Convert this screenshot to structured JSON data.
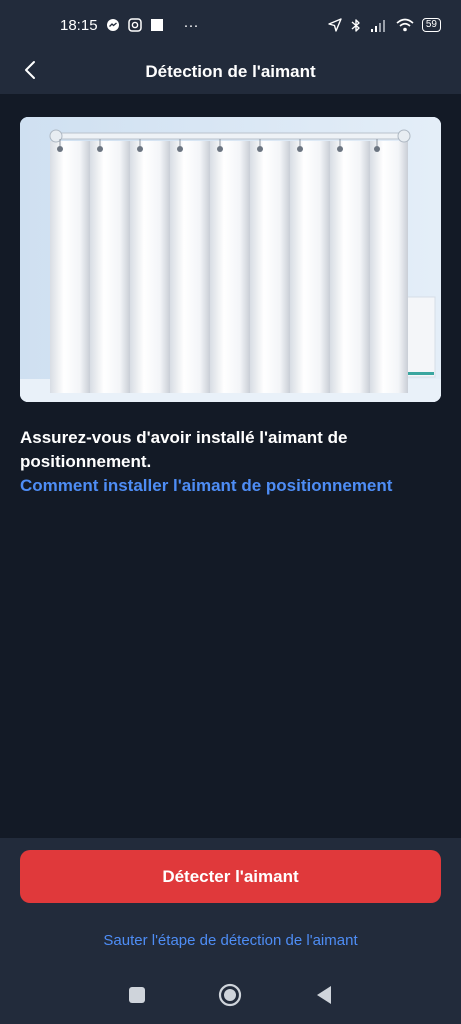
{
  "status_bar": {
    "time": "18:15",
    "more": "···",
    "battery": "59",
    "icons": [
      "messenger-icon",
      "camera-icon",
      "square-app-icon",
      "location-icon",
      "bluetooth-icon",
      "signal-icon",
      "wifi-icon",
      "battery-icon"
    ]
  },
  "header": {
    "title": "Détection de l'aimant",
    "back_icon": "chevron-left-icon"
  },
  "content": {
    "instruction": "Assurez-vous d'avoir installé l'aimant de positionnement.",
    "help_link": "Comment installer l'aimant de positionnement"
  },
  "footer": {
    "detect_button": "Détecter l'aimant",
    "skip_link": "Sauter l'étape de détection de l'aimant"
  },
  "navigation": {
    "icons": [
      "recents-square-icon",
      "home-circle-icon",
      "back-triangle-icon"
    ]
  },
  "colors": {
    "background": "#131a26",
    "header": "#222b3b",
    "accent_red": "#e0393b",
    "link_blue": "#4e8df5"
  }
}
